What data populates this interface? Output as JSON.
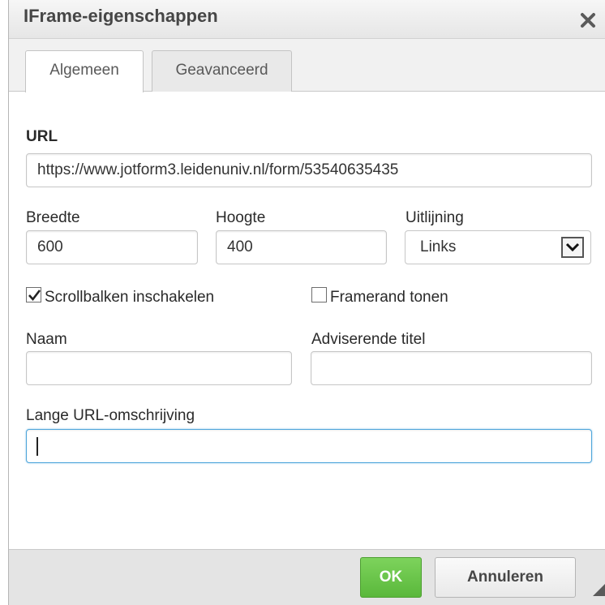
{
  "dialog": {
    "title": "IFrame-eigenschappen",
    "close_icon": "close-icon"
  },
  "tabs": [
    {
      "label": "Algemeen",
      "active": true
    },
    {
      "label": "Geavanceerd",
      "active": false
    }
  ],
  "form": {
    "url": {
      "label": "URL",
      "value": "https://www.jotform3.leidenuniv.nl/form/53540635435"
    },
    "width": {
      "label": "Breedte",
      "value": "600"
    },
    "height": {
      "label": "Hoogte",
      "value": "400"
    },
    "alignment": {
      "label": "Uitlijning",
      "value": "Links",
      "arrow_icon": "chevron-down-icon"
    },
    "scrollbars": {
      "label": "Scrollbalken inschakelen",
      "checked": true
    },
    "frameborder": {
      "label": "Framerand tonen",
      "checked": false
    },
    "name": {
      "label": "Naam",
      "value": ""
    },
    "advisory_title": {
      "label": "Adviserende titel",
      "value": ""
    },
    "long_desc": {
      "label": "Lange URL-omschrijving",
      "value": ""
    }
  },
  "footer": {
    "ok_label": "OK",
    "cancel_label": "Annuleren",
    "ok_color": "#5ab83b",
    "resize_icon": "resize-grip-icon"
  }
}
